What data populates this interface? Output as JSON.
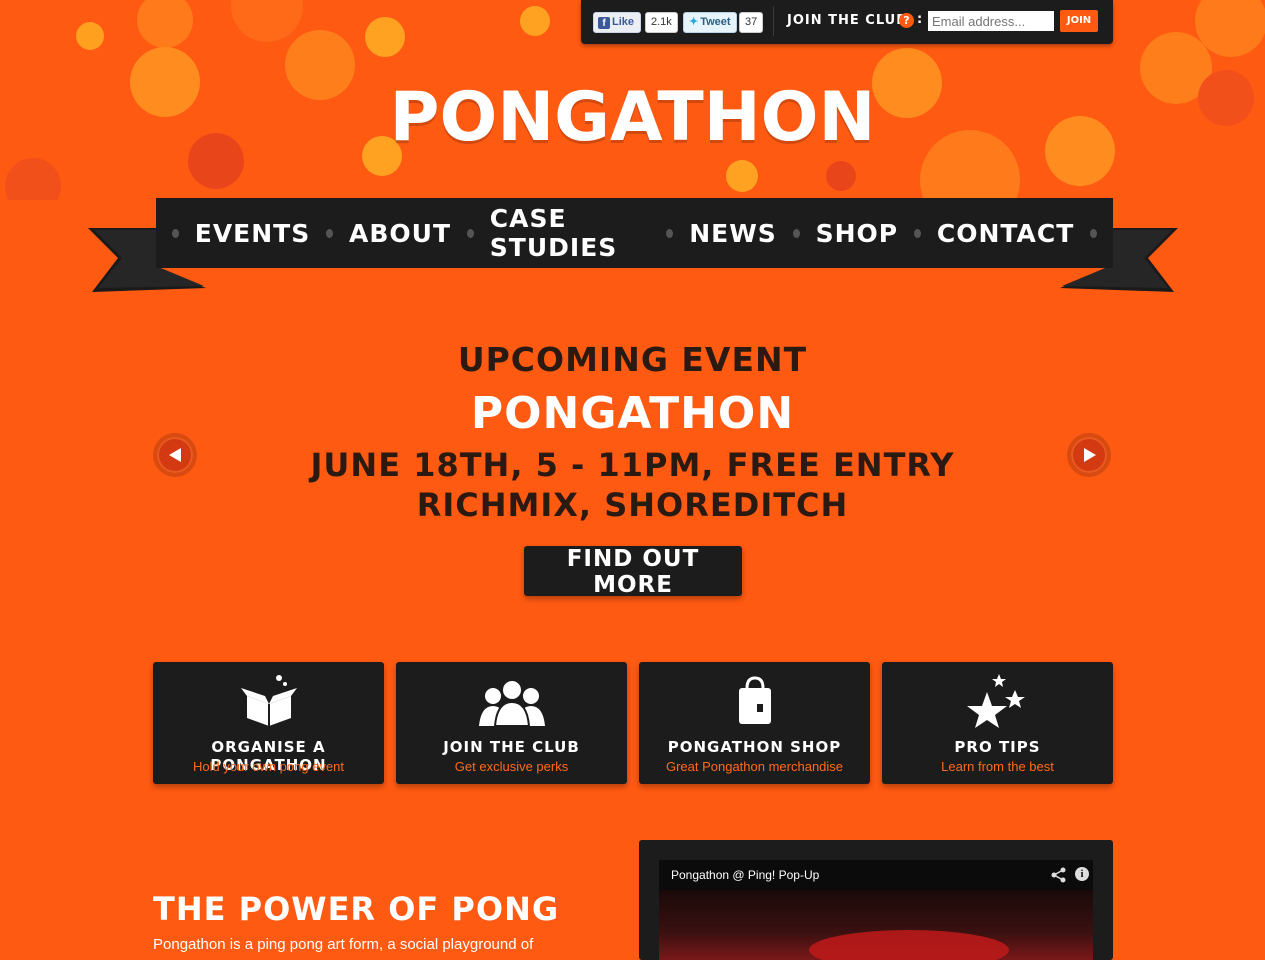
{
  "topbar": {
    "like_label": "Like",
    "like_count": "2.1k",
    "tweet_label": "Tweet",
    "tweet_count": "37",
    "join_label": "JOIN THE CLUB",
    "help_glyph": "?",
    "email_placeholder": "Email address...",
    "join_button": "JOIN"
  },
  "logo": {
    "text": "PONGATHON"
  },
  "nav": {
    "items": [
      "EVENTS",
      "ABOUT",
      "CASE STUDIES",
      "NEWS",
      "SHOP",
      "CONTACT"
    ]
  },
  "hero": {
    "heading": "UPCOMING EVENT",
    "event_name": "PONGATHON",
    "date_line": "JUNE 18TH, 5 - 11PM, FREE ENTRY",
    "venue_line": "RICHMIX, SHOREDITCH",
    "cta": "FIND OUT MORE"
  },
  "tiles": [
    {
      "title": "ORGANISE A PONGATHON",
      "subtitle": "Hold your own pong event",
      "icon": "gift-box-icon"
    },
    {
      "title": "JOIN THE CLUB",
      "subtitle": "Get exclusive perks",
      "icon": "group-icon"
    },
    {
      "title": "PONGATHON SHOP",
      "subtitle": "Great Pongathon merchandise",
      "icon": "shopping-bag-icon"
    },
    {
      "title": "PRO TIPS",
      "subtitle": "Learn from the best",
      "icon": "stars-icon"
    }
  ],
  "about": {
    "heading": "THE POWER OF PONG",
    "text": "Pongathon is a ping pong art form, a social playground of"
  },
  "video": {
    "title": "Pongathon @ Ping! Pop-Up"
  },
  "colors": {
    "brand_orange": "#ff5a12",
    "panel_dark": "#1c1c1c",
    "accent_orange": "#ff6a1e"
  }
}
